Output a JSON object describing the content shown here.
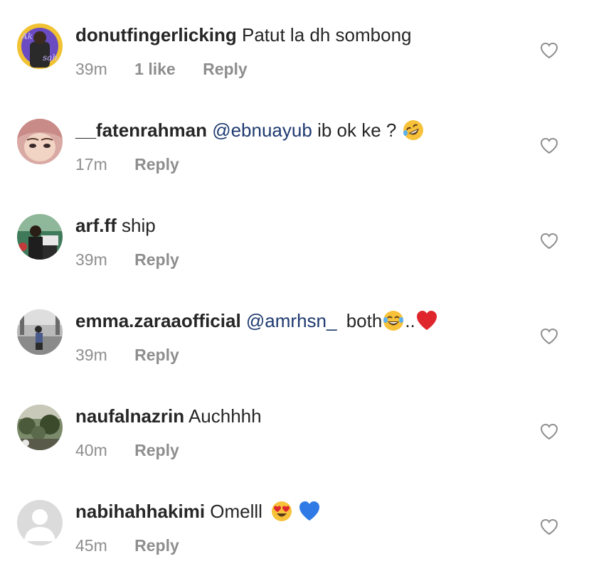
{
  "comments": [
    {
      "username": "donutfingerlicking",
      "text": "Patut la dh sombong",
      "mention": "",
      "time": "39m",
      "likes": "1 like",
      "reply": "Reply"
    },
    {
      "username": "__fatenrahman",
      "mention": "@ebnuayub",
      "text": "ib ok ke ?",
      "emoji_1": "rolling-on-floor-laughing",
      "time": "17m",
      "reply": "Reply"
    },
    {
      "username": "arf.ff",
      "text": "ship",
      "time": "39m",
      "reply": "Reply"
    },
    {
      "username": "emma.zaraaofficial",
      "mention": "@amrhsn_",
      "text": "both",
      "emoji_1": "face-with-tears-of-joy",
      "dots": "..",
      "emoji_2": "red-heart",
      "time": "39m",
      "reply": "Reply"
    },
    {
      "username": "naufalnazrin",
      "text": "Auchhhh",
      "time": "40m",
      "reply": "Reply"
    },
    {
      "username": "nabihahhakimi",
      "text": "Omelll",
      "emoji_1": "smiling-face-with-heart-eyes",
      "emoji_2": "blue-heart",
      "time": "45m",
      "reply": "Reply"
    }
  ],
  "icons": {
    "like": "heart-outline-icon",
    "default_avatar": "default-avatar-icon"
  },
  "colors": {
    "text": "#262626",
    "meta": "#8e8e8e",
    "mention": "#1f3a70",
    "heart_stroke": "#8e8e8e"
  }
}
